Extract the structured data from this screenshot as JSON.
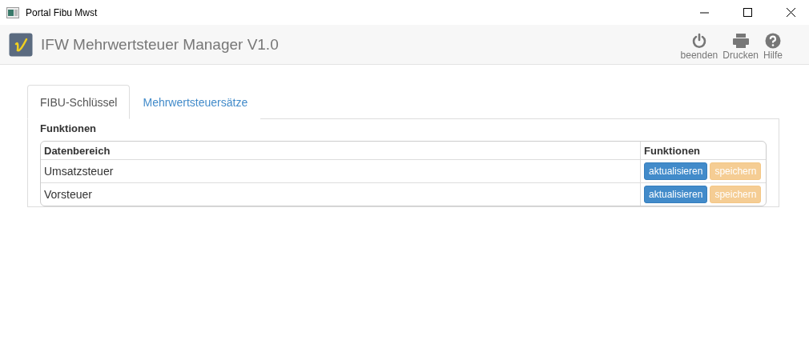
{
  "window": {
    "title": "Portal Fibu Mwst"
  },
  "header": {
    "title": "IFW Mehrwertsteuer Manager V1.0",
    "actions": [
      {
        "kind": "power",
        "label": "beenden"
      },
      {
        "kind": "print",
        "label": "Drucken"
      },
      {
        "kind": "help",
        "label": "Hilfe"
      }
    ]
  },
  "tabs": [
    {
      "label": "FIBU-Schlüssel",
      "selected": true
    },
    {
      "label": "Mehrwertsteuersätze",
      "selected": false
    }
  ],
  "section_title": "Funktionen",
  "table": {
    "columns": [
      "Datenbereich",
      "Funktionen"
    ],
    "rows": [
      {
        "name": "Umsatzsteuer",
        "buttons": [
          {
            "label": "aktualisieren",
            "kind": "primary",
            "disabled": false
          },
          {
            "label": "speichern",
            "kind": "warning",
            "disabled": true
          }
        ]
      },
      {
        "name": "Vorsteuer",
        "buttons": [
          {
            "label": "aktualisieren",
            "kind": "primary",
            "disabled": false
          },
          {
            "label": "speichern",
            "kind": "warning",
            "disabled": true
          }
        ]
      }
    ]
  }
}
